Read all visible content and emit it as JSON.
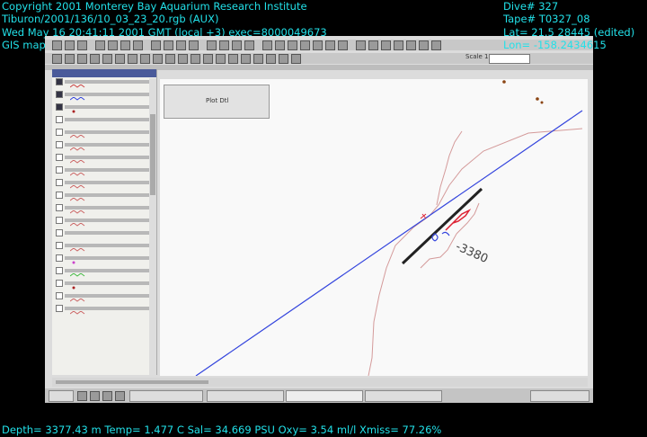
{
  "overlay": {
    "copyright": "Copyright 2001 Monterey Bay Aquarium Research Institute",
    "file_path": "Tiburon/2001/136/10_03_23_20.rgb (AUX)",
    "datetime": "Wed May 16 20:41:11 2001  GMT (local +3)  exec=8000049673",
    "gis_label": "GIS map",
    "dive": "Dive# 327",
    "tape": "Tape# T0327_08",
    "lat": "Lat= 21.5 28445 (edited)",
    "lon": "Lon= -158.2434615",
    "bottom_line": "Depth= 3377.43 m  Temp= 1.477 C  Sal= 34.669 PSU  Oxy= 3.54 ml/l  Xmiss= 77.26%"
  },
  "app": {
    "scale_label": "Scale 1:",
    "map_label": "-3380",
    "panel_label": "Plot Dtl"
  },
  "colors": {
    "overlay_text": "#22e0e8",
    "track_line": "#3344dd",
    "contour": "#d49a9a",
    "track_red": "#dd2233"
  }
}
